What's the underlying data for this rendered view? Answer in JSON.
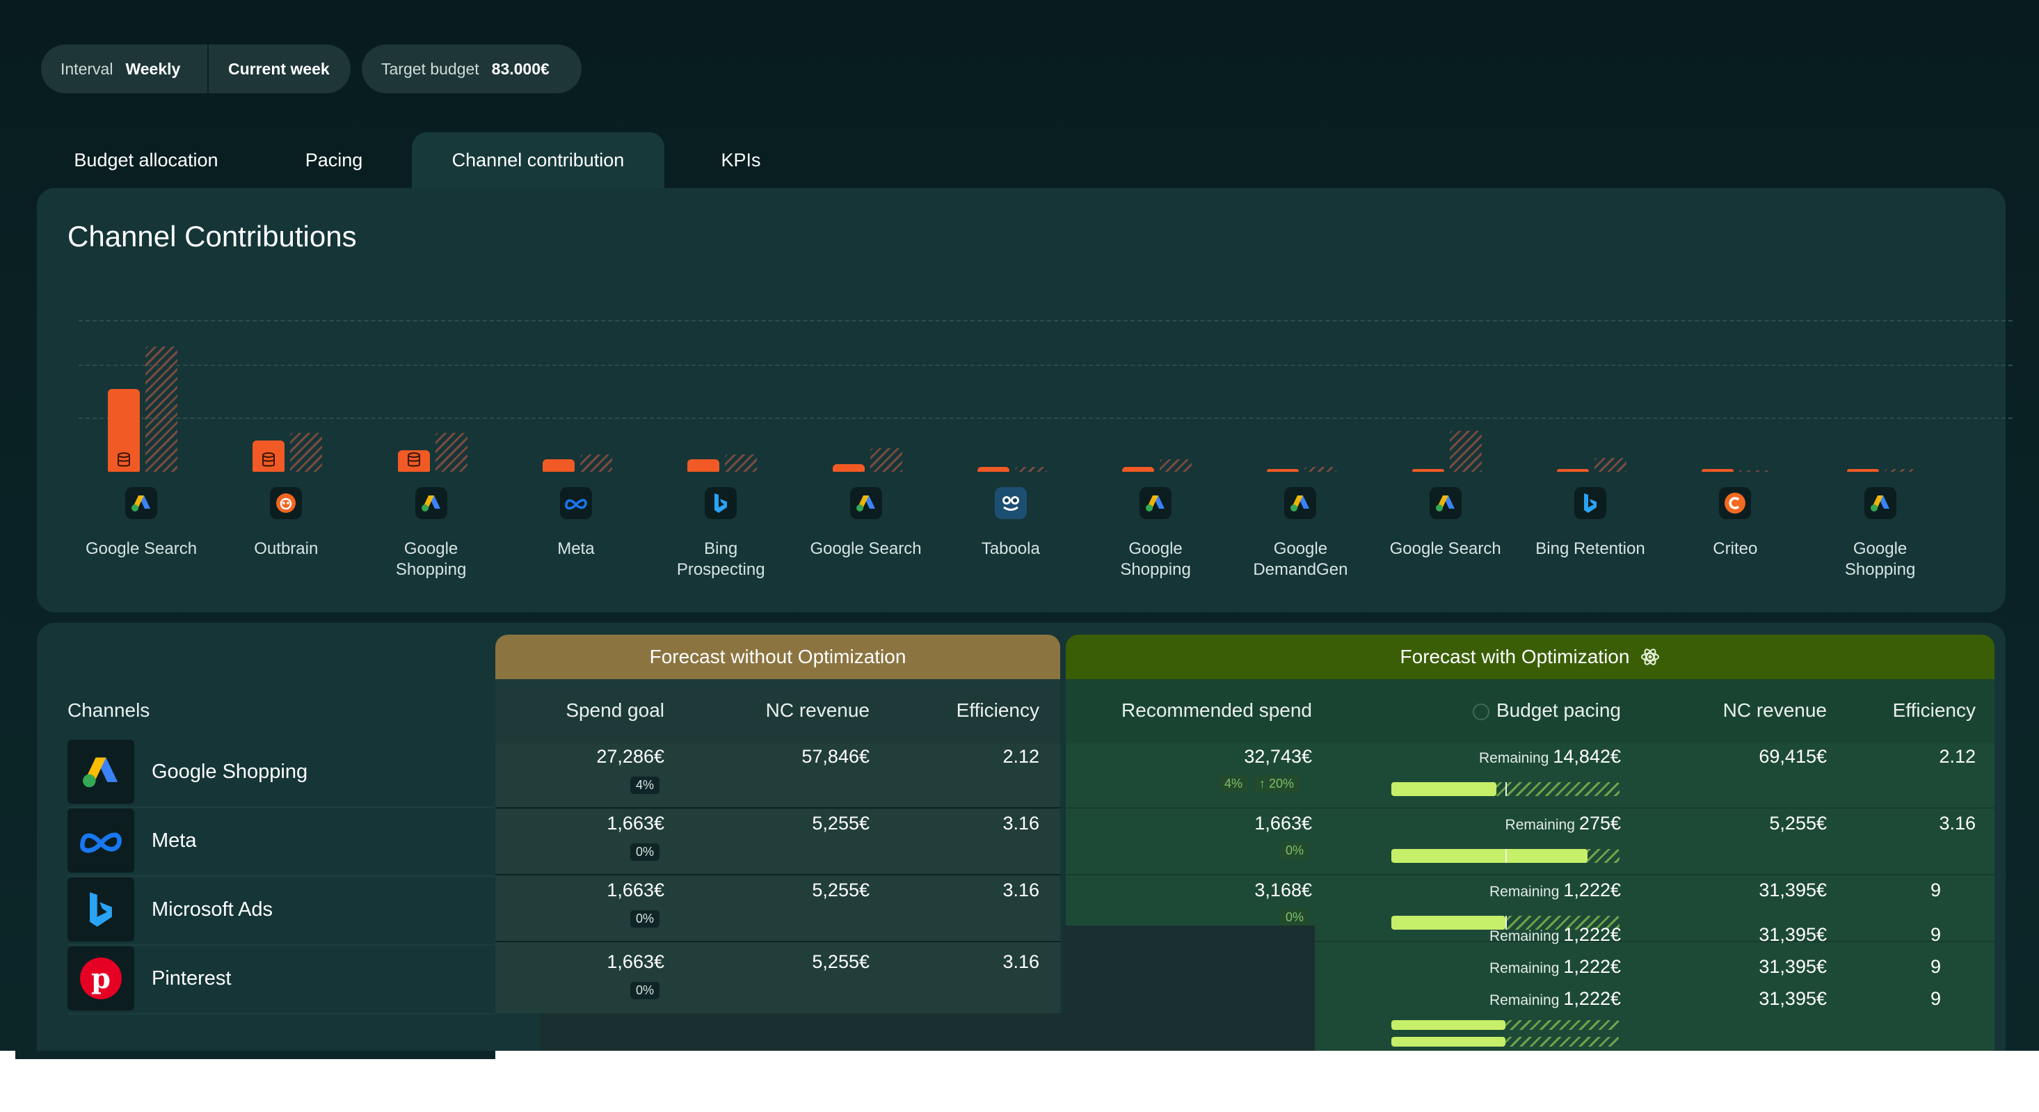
{
  "filters": {
    "interval_label": "Interval",
    "interval_value": "Weekly",
    "period": "Current week",
    "budget_label": "Target budget",
    "budget_value": "83.000€"
  },
  "tabs": [
    "Budget allocation",
    "Pacing",
    "Channel contribution",
    "KPIs"
  ],
  "active_tab": "Channel contribution",
  "chart_title": "Channel Contributions",
  "chart_data": {
    "type": "bar",
    "categories": [
      "Google Search",
      "Outbrain",
      "Google Shopping",
      "Meta",
      "Bing Prospecting",
      "Google Search",
      "Taboola",
      "Google Shopping",
      "Google DemandGen",
      "Google Search",
      "Bing Retention",
      "Criteo",
      "Google Shopping"
    ],
    "series": [
      {
        "values": [
          0.66,
          0.25,
          0.17,
          0.1,
          0.1,
          0.06,
          0.04,
          0.04,
          0.02,
          0.01,
          0.01,
          0.01,
          0.01
        ]
      },
      {
        "values": [
          1.0,
          0.31,
          0.31,
          0.14,
          0.14,
          0.19,
          0.04,
          0.1,
          0.04,
          0.33,
          0.11,
          0.0,
          0.02
        ]
      }
    ],
    "ylim": [
      0,
      1
    ],
    "grid": true
  },
  "chart_icons": [
    "google-ads-icon",
    "outbrain-icon",
    "google-ads-icon",
    "meta-icon",
    "bing-icon",
    "google-ads-icon",
    "taboola-icon",
    "google-ads-icon",
    "google-ads-icon",
    "google-ads-icon",
    "bing-icon",
    "criteo-icon",
    "google-ads-icon"
  ],
  "table": {
    "channels_label": "Channels",
    "group_without": "Forecast without Optimization",
    "group_with": "Forecast with Optimization",
    "headers": {
      "spend_goal": "Spend goal",
      "nc_revenue": "NC revenue",
      "efficiency": "Efficiency",
      "recommended_spend": "Recommended spend",
      "budget_pacing": "Budget pacing",
      "nc_revenue_opt": "NC revenue",
      "efficiency_opt": "Efficiency"
    },
    "remaining_label": "Remaining",
    "channels": [
      {
        "name": "Google Shopping",
        "icon": "google-ads-icon"
      },
      {
        "name": "Meta",
        "icon": "meta-icon"
      },
      {
        "name": "Microsoft Ads",
        "icon": "bing-icon"
      },
      {
        "name": "Pinterest",
        "icon": "pinterest-icon"
      }
    ],
    "rows_without": [
      {
        "spend": "27,286€",
        "chip": "4%",
        "revenue": "57,846€",
        "efficiency": "2.12"
      },
      {
        "spend": "1,663€",
        "chip": "0%",
        "revenue": "5,255€",
        "efficiency": "3.16"
      },
      {
        "spend": "1,663€",
        "chip": "0%",
        "revenue": "5,255€",
        "efficiency": "3.16"
      },
      {
        "spend": "1,663€",
        "chip": "0%",
        "revenue": "5,255€",
        "efficiency": "3.16"
      }
    ],
    "rows_with": [
      {
        "spend": "32,743€",
        "chip": "4%",
        "chip_up": "20%",
        "remaining": "14,842€",
        "pacing": 0.46,
        "revenue": "69,415€",
        "efficiency": "2.12"
      },
      {
        "spend": "1,663€",
        "chip": "0%",
        "remaining": "275€",
        "pacing": 0.86,
        "revenue": "5,255€",
        "efficiency": "3.16"
      },
      {
        "spend": "3,168€",
        "chip": "0%",
        "remaining": "1,222€",
        "pacing": 0.5,
        "revenue": "31,395€",
        "efficiency": "9"
      }
    ],
    "overflow_rows": [
      {
        "remaining": "1,222€",
        "revenue": "31,395€",
        "efficiency": "9"
      },
      {
        "remaining": "1,222€",
        "revenue": "31,395€",
        "efficiency": "9"
      },
      {
        "remaining": "1,222€",
        "revenue": "31,395€",
        "efficiency": "9"
      }
    ]
  },
  "colors": {
    "background": "#0a2124",
    "panel": "#153537",
    "bar_accent": "#f15a24",
    "header_without": "#8b7440",
    "header_with": "#3a5e05",
    "pacing_fill": "#c6ef6a"
  }
}
